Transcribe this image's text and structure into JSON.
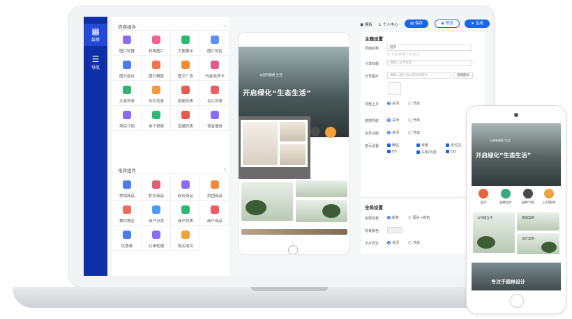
{
  "nav": {
    "items": [
      {
        "label": "装修",
        "icon": "grid-icon",
        "active": true
      },
      {
        "label": "导航",
        "icon": "list-icon",
        "active": false
      }
    ]
  },
  "widgets": {
    "content_group": {
      "title": "内容组件",
      "items": [
        {
          "label": "图片轮播",
          "color": "#8b6cf6"
        },
        {
          "label": "封面图片",
          "color": "#f06292"
        },
        {
          "label": "大图展示",
          "color": "#2eb872"
        },
        {
          "label": "图片热区",
          "color": "#5c8df6"
        },
        {
          "label": "图文组合",
          "color": "#4a7cf0"
        },
        {
          "label": "图片橱窗",
          "color": "#f2744a"
        },
        {
          "label": "图文广告",
          "color": "#f48a34"
        },
        {
          "label": "内容选项卡",
          "color": "#e05a8a"
        },
        {
          "label": "文章列表",
          "color": "#33b46c"
        },
        {
          "label": "专栏列表",
          "color": "#f59a3c"
        },
        {
          "label": "相册列表",
          "color": "#e85a4f"
        },
        {
          "label": "名片列表",
          "color": "#ef5a64"
        },
        {
          "label": "项目介绍",
          "color": "#8f6af0"
        },
        {
          "label": "单个视频",
          "color": "#2eb872"
        },
        {
          "label": "直播列表",
          "color": "#e8564f"
        },
        {
          "label": "语音播放",
          "color": "#8b6cf6"
        }
      ]
    },
    "commerce_group": {
      "title": "电商组件",
      "items": [
        {
          "label": "常规商品",
          "color": "#4a7cf0"
        },
        {
          "label": "秒杀商品",
          "color": "#e85a7a"
        },
        {
          "label": "砍价商品",
          "color": "#8b6cf6"
        },
        {
          "label": "拼团商品",
          "color": "#f28a3c"
        },
        {
          "label": "预约预定",
          "color": "#ef6b5a"
        },
        {
          "label": "商户分类",
          "color": "#4a9cf0"
        },
        {
          "label": "商户列表",
          "color": "#2eb872"
        },
        {
          "label": "商户商品",
          "color": "#ef5a64"
        },
        {
          "label": "优惠券",
          "color": "#4a7cf0"
        },
        {
          "label": "订单轮播",
          "color": "#8b6cf6"
        },
        {
          "label": "购买成功",
          "color": "#f2a23c"
        }
      ]
    }
  },
  "toolbar": {
    "template": "模板",
    "user_center": "个人中心",
    "save": "保存",
    "preview": "预览",
    "generate": "生成"
  },
  "canvas": {
    "hero_subtitle": "公园有颜值 生活",
    "hero_title": "开启绿化“生态生活”"
  },
  "settings": {
    "theme_title": "主题设置",
    "page_name_label": "页面名称",
    "page_name_value": "首页",
    "page_name_hint": "注: 页面名称用于后台区分",
    "share_title_label": "分享标题",
    "share_title_placeholder": "请输入分享标题",
    "share_image_label": "分享图片",
    "share_image_placeholder": "请输入图片地址或选择图片",
    "share_image_button": "选择图片",
    "top_bar_label": "顶部上方",
    "option_off": "关闭",
    "option_on": "开启",
    "kefu_label": "底部导航",
    "member_label": "会员功能",
    "share_settings_label": "首页设置",
    "share_channels": [
      "微信",
      "百度",
      "支付宝",
      "H5",
      "头条/抖音",
      "QQ"
    ],
    "global_title": "全局设置",
    "bg_label": "全局背景",
    "bg_opt1": "颜色",
    "bg_opt2": "图片+颜色",
    "bg_color_label": "背景颜色",
    "card_style_label": "卡片样式"
  },
  "phone": {
    "hero_subtitle": "公园有颜值 生活",
    "hero_title": "开启绿化“生态生活”",
    "circles": [
      {
        "label": "设计",
        "color": "#e8643c"
      },
      {
        "label": "园林设计",
        "color": "#3aa87a"
      },
      {
        "label": "园林介绍",
        "color": "#4a4a4a"
      },
      {
        "label": "公司新闻",
        "color": "#f2a23c"
      }
    ],
    "card1_title": "公司成立于",
    "card2_title": "景观案例",
    "card3_title": "设计案例",
    "bottom_title": "专注于园林设计"
  }
}
